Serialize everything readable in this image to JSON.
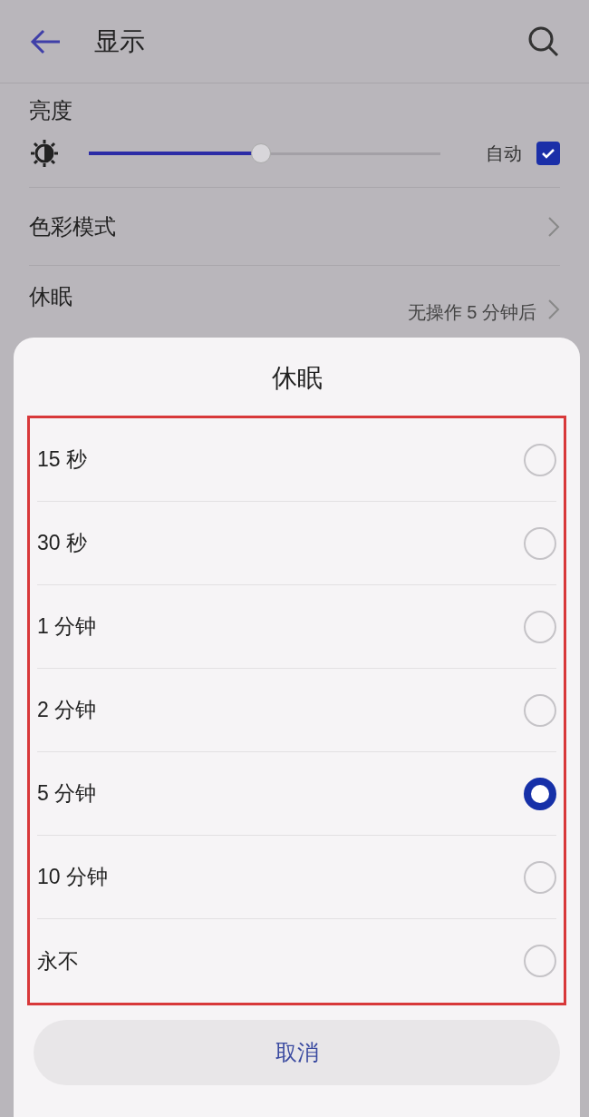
{
  "header": {
    "title": "显示"
  },
  "brightness": {
    "label": "亮度",
    "level": 0.49,
    "auto_label": "自动",
    "auto_checked": true
  },
  "settings": [
    {
      "label": "色彩模式"
    },
    {
      "label": "休眠",
      "value": "无操作 5 分钟后"
    }
  ],
  "dialog": {
    "title": "休眠",
    "options": [
      {
        "label": "15 秒",
        "selected": false
      },
      {
        "label": "30 秒",
        "selected": false
      },
      {
        "label": "1 分钟",
        "selected": false
      },
      {
        "label": "2 分钟",
        "selected": false
      },
      {
        "label": "5 分钟",
        "selected": true
      },
      {
        "label": "10 分钟",
        "selected": false
      },
      {
        "label": "永不",
        "selected": false
      }
    ],
    "cancel": "取消"
  }
}
